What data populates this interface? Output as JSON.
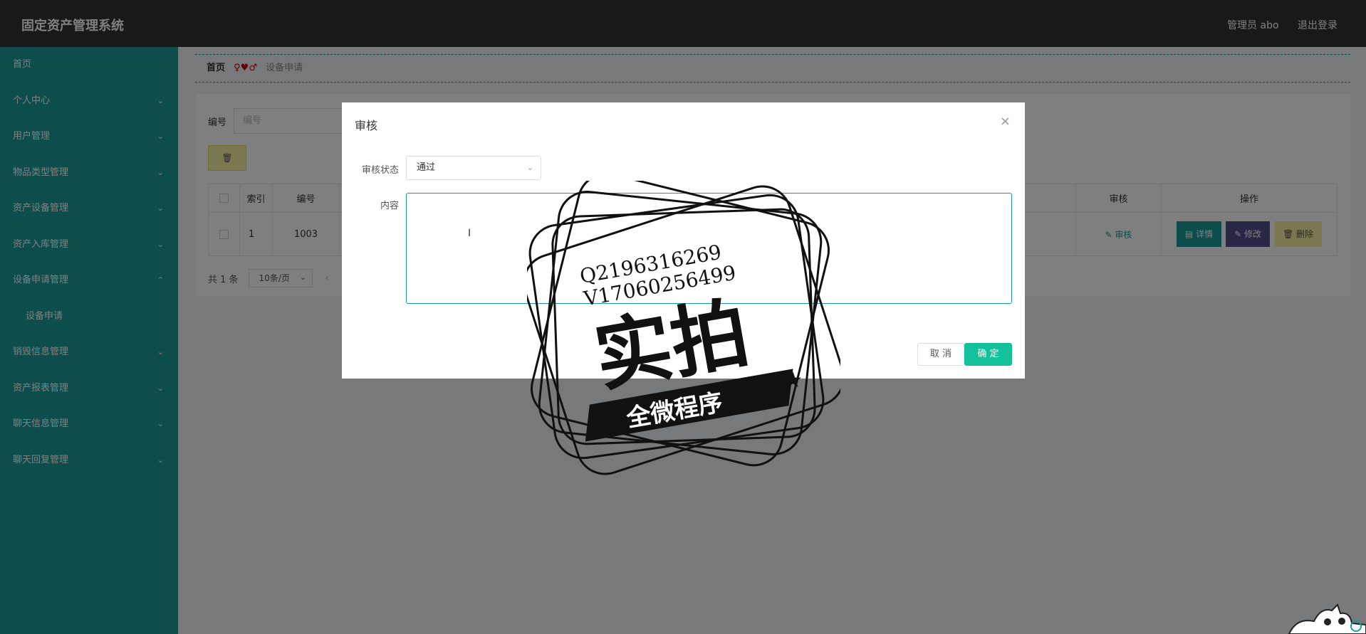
{
  "header": {
    "title": "固定资产管理系统",
    "user_label": "管理员 abo",
    "logout_label": "退出登录"
  },
  "sidebar": {
    "items": [
      {
        "label": "首页",
        "expandable": false
      },
      {
        "label": "个人中心",
        "expandable": true
      },
      {
        "label": "用户管理",
        "expandable": true
      },
      {
        "label": "物品类型管理",
        "expandable": true
      },
      {
        "label": "资产设备管理",
        "expandable": true
      },
      {
        "label": "资产入库管理",
        "expandable": true
      },
      {
        "label": "设备申请管理",
        "expandable": true,
        "expanded": true
      },
      {
        "label": "设备申请",
        "sub": true
      },
      {
        "label": "销毁信息管理",
        "expandable": true
      },
      {
        "label": "资产报表管理",
        "expandable": true
      },
      {
        "label": "聊天信息管理",
        "expandable": true
      },
      {
        "label": "聊天回复管理",
        "expandable": true
      }
    ]
  },
  "breadcrumb": {
    "home": "首页",
    "separator": "♀♥♂",
    "current": "设备申请"
  },
  "search": {
    "label": "编号",
    "placeholder": "编号"
  },
  "table": {
    "headers": [
      "索引",
      "编号",
      "审核",
      "操作"
    ],
    "rows": [
      {
        "index": "1",
        "number": "1003",
        "audit": "审核"
      }
    ],
    "actions": {
      "detail": "详情",
      "edit": "修改",
      "delete": "删除"
    }
  },
  "pager": {
    "total": "共 1 条",
    "page_size": "10条/页"
  },
  "dialog": {
    "title": "审核",
    "status_label": "审核状态",
    "status_value": "通过",
    "content_label": "内容",
    "cancel_label": "取 消",
    "ok_label": "确 定"
  },
  "watermark": {
    "line1": "Q2196316269",
    "line2": "V17060256499",
    "big": "实拍",
    "ribbon": "全微程序"
  },
  "colors": {
    "sidebar": "#1a9c99",
    "topbar": "#333333",
    "primary": "#13c29a",
    "edit": "#534f8a",
    "warn": "#f5f0a0"
  }
}
